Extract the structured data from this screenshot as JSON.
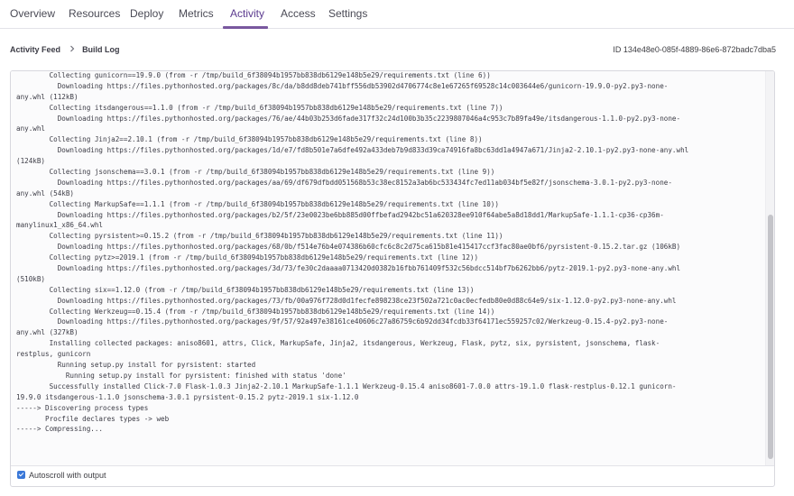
{
  "tabs": [
    {
      "label": "Overview",
      "active": false
    },
    {
      "label": "Resources",
      "active": false
    },
    {
      "label": "Deploy",
      "active": false
    },
    {
      "label": "Metrics",
      "active": false
    },
    {
      "label": "Activity",
      "active": true
    },
    {
      "label": "Access",
      "active": false
    },
    {
      "label": "Settings",
      "active": false
    }
  ],
  "breadcrumb": {
    "parent": "Activity Feed",
    "separator_icon": "chevron-right-icon",
    "current": "Build Log"
  },
  "build_id": "ID 134e48e0-085f-4889-86e6-872badc7dba5",
  "log": {
    "lines": [
      "        Collecting gunicorn==19.9.0 (from -r /tmp/build_6f38094b1957bb838db6129e148b5e29/requirements.txt (line 6))",
      "          Downloading https://files.pythonhosted.org/packages/8c/da/b8dd8deb741bff556db53902d4706774c8e1e67265f69528c14c003644e6/gunicorn-19.9.0-py2.py3-none-",
      "any.whl (112kB)",
      "        Collecting itsdangerous==1.1.0 (from -r /tmp/build_6f38094b1957bb838db6129e148b5e29/requirements.txt (line 7))",
      "          Downloading https://files.pythonhosted.org/packages/76/ae/44b03b253d6fade317f32c24d100b3b35c2239807046a4c953c7b89fa49e/itsdangerous-1.1.0-py2.py3-none-",
      "any.whl",
      "        Collecting Jinja2==2.10.1 (from -r /tmp/build_6f38094b1957bb838db6129e148b5e29/requirements.txt (line 8))",
      "          Downloading https://files.pythonhosted.org/packages/1d/e7/fd8b501e7a6dfe492a433deb7b9d833d39ca74916fa8bc63dd1a4947a671/Jinja2-2.10.1-py2.py3-none-any.whl",
      "(124kB)",
      "        Collecting jsonschema==3.0.1 (from -r /tmp/build_6f38094b1957bb838db6129e148b5e29/requirements.txt (line 9))",
      "          Downloading https://files.pythonhosted.org/packages/aa/69/df679dfbdd051568b53c38ec8152a3ab6bc533434fc7ed11ab034bf5e82f/jsonschema-3.0.1-py2.py3-none-",
      "any.whl (54kB)",
      "        Collecting MarkupSafe==1.1.1 (from -r /tmp/build_6f38094b1957bb838db6129e148b5e29/requirements.txt (line 10))",
      "          Downloading https://files.pythonhosted.org/packages/b2/5f/23e0023be6bb885d00ffbefad2942bc51a620328ee910f64abe5a8d18dd1/MarkupSafe-1.1.1-cp36-cp36m-",
      "manylinux1_x86_64.whl",
      "        Collecting pyrsistent>=0.15.2 (from -r /tmp/build_6f38094b1957bb838db6129e148b5e29/requirements.txt (line 11))",
      "          Downloading https://files.pythonhosted.org/packages/68/0b/f514e76b4e074386b60cfc6c8c2d75ca615b81e415417ccf3fac80ae0bf6/pyrsistent-0.15.2.tar.gz (106kB)",
      "        Collecting pytz>=2019.1 (from -r /tmp/build_6f38094b1957bb838db6129e148b5e29/requirements.txt (line 12))",
      "          Downloading https://files.pythonhosted.org/packages/3d/73/fe30c2daaaa0713420d0382b16fbb761409f532c56bdcc514bf7b6262bb6/pytz-2019.1-py2.py3-none-any.whl",
      "(510kB)",
      "        Collecting six==1.12.0 (from -r /tmp/build_6f38094b1957bb838db6129e148b5e29/requirements.txt (line 13))",
      "          Downloading https://files.pythonhosted.org/packages/73/fb/00a976f728d0d1fecfe898238ce23f502a721c0ac0ecfedb80e0d88c64e9/six-1.12.0-py2.py3-none-any.whl",
      "        Collecting Werkzeug==0.15.4 (from -r /tmp/build_6f38094b1957bb838db6129e148b5e29/requirements.txt (line 14))",
      "          Downloading https://files.pythonhosted.org/packages/9f/57/92a497e38161ce40606c27a86759c6b92dd34fcdb33f64171ec559257c02/Werkzeug-0.15.4-py2.py3-none-",
      "any.whl (327kB)",
      "        Installing collected packages: aniso8601, attrs, Click, MarkupSafe, Jinja2, itsdangerous, Werkzeug, Flask, pytz, six, pyrsistent, jsonschema, flask-",
      "restplus, gunicorn",
      "          Running setup.py install for pyrsistent: started",
      "            Running setup.py install for pyrsistent: finished with status 'done'",
      "        Successfully installed Click-7.0 Flask-1.0.3 Jinja2-2.10.1 MarkupSafe-1.1.1 Werkzeug-0.15.4 aniso8601-7.0.0 attrs-19.1.0 flask-restplus-0.12.1 gunicorn-",
      "19.9.0 itsdangerous-1.1.0 jsonschema-3.0.1 pyrsistent-0.15.2 pytz-2019.1 six-1.12.0",
      "-----> Discovering process types",
      "       Procfile declares types -> web",
      "-----> Compressing..."
    ]
  },
  "autoscroll": {
    "label": "Autoscroll with output",
    "checked": true
  },
  "colors": {
    "accent": "#79589f",
    "checkbox": "#3a78d8"
  }
}
